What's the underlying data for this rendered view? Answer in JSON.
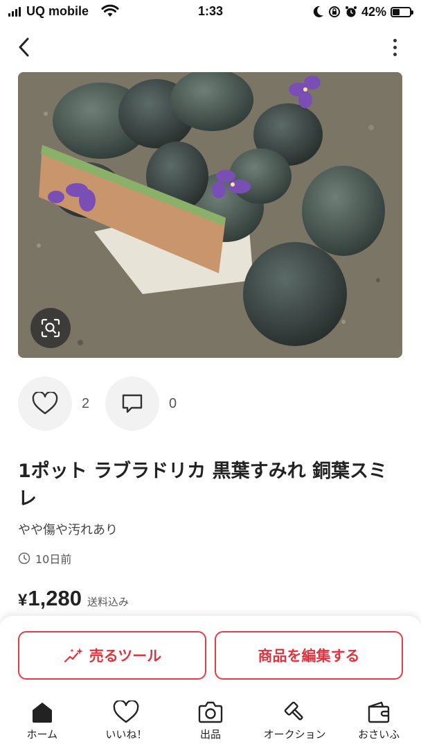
{
  "status_bar": {
    "carrier": "UQ mobile",
    "time": "1:33",
    "battery_percent": "42%",
    "battery_level": 0.42
  },
  "image": {
    "icons": [
      "lens-search-icon"
    ]
  },
  "actions": {
    "like_count": "2",
    "comment_count": "0"
  },
  "item": {
    "title": "1ポット ラブラドリカ 黒葉すみれ 銅葉スミレ",
    "condition": "やや傷や汚れあり",
    "posted": "10日前",
    "currency": "¥",
    "price": "1,280",
    "shipping": "送料込み"
  },
  "buttons": {
    "sell_tool": "売るツール",
    "edit_item": "商品を編集する"
  },
  "tabs": [
    {
      "label": "ホーム",
      "icon": "home-icon"
    },
    {
      "label": "いいね！",
      "icon": "heart-icon"
    },
    {
      "label": "出品",
      "icon": "camera-icon"
    },
    {
      "label": "オークション",
      "icon": "gavel-icon"
    },
    {
      "label": "おさいふ",
      "icon": "wallet-icon"
    }
  ],
  "colors": {
    "accent": "#e83a46",
    "text": "#222222"
  }
}
